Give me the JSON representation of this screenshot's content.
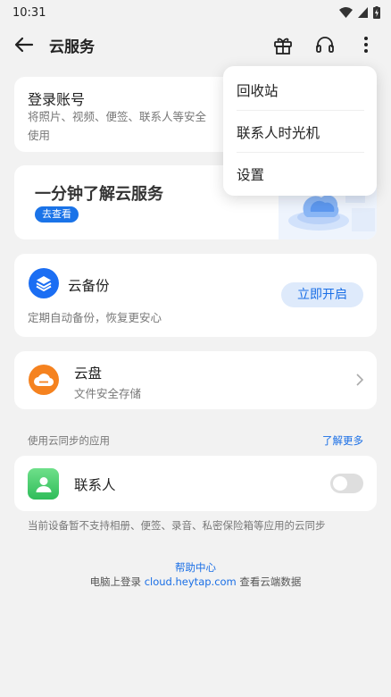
{
  "status": {
    "time": "10:31"
  },
  "header": {
    "title": "云服务"
  },
  "login": {
    "title": "登录账号",
    "desc_line1": "将照片、视频、便签、联系人等安全",
    "desc_line2": "使用"
  },
  "promo": {
    "title": "一分钟了解云服务",
    "button": "去查看"
  },
  "backup": {
    "title": "云备份",
    "desc": "定期自动备份，恢复更安心",
    "button": "立即开启"
  },
  "disk": {
    "title": "云盘",
    "desc": "文件安全存储"
  },
  "sync_section": {
    "label": "使用云同步的应用",
    "more": "了解更多"
  },
  "contacts": {
    "title": "联系人",
    "toggle_on": false
  },
  "note": "当前设备暂不支持相册、便签、录音、私密保险箱等应用的云同步",
  "footer": {
    "help": "帮助中心",
    "prefix": "电脑上登录 ",
    "link": "cloud.heytap.com",
    "suffix": " 查看云端数据"
  },
  "menu": {
    "items": [
      "回收站",
      "联系人时光机",
      "设置"
    ]
  },
  "colors": {
    "accent": "#1a6fe6",
    "backup_icon": "#1b6ef3",
    "disk_icon": "#f5821f",
    "contacts_icon": "#2fbd5a"
  }
}
